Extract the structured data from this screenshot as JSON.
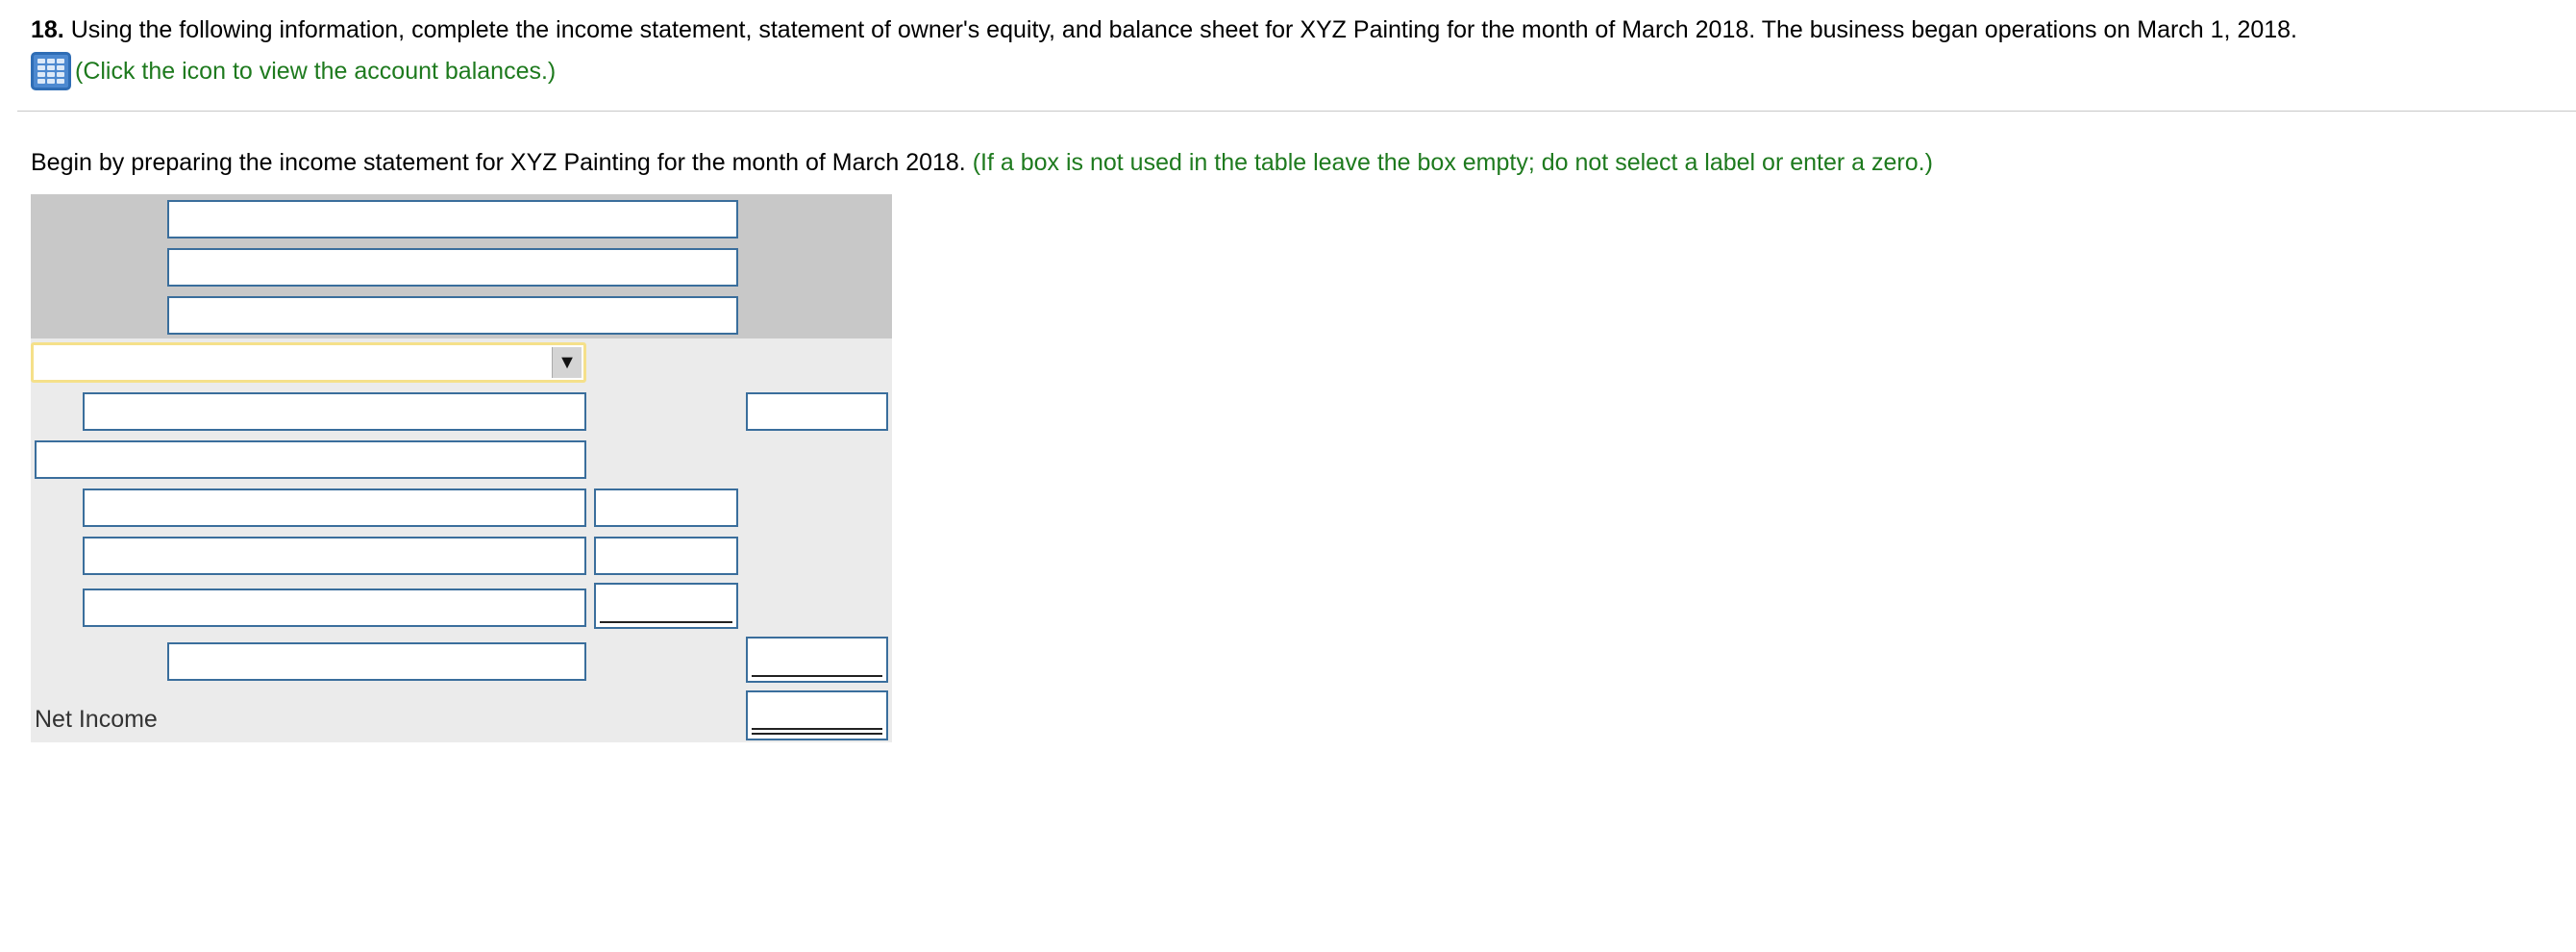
{
  "question": {
    "number": "18.",
    "text": "Using the following information, complete the income statement, statement of owner's equity, and balance sheet for XYZ Painting for the month of March 2018. The business began operations on March 1, 2018.",
    "account_link": "(Click the icon to view the account balances.)",
    "account_icon": "table-grid-icon"
  },
  "instruction": {
    "text": "Begin by preparing the income statement for XYZ Painting for the month of March 2018.",
    "note": "(If a box is not used in the table leave the box empty; do not select a label or enter a zero.)"
  },
  "statement": {
    "header_inputs": [
      "",
      "",
      ""
    ],
    "revenue_dropdown": {
      "selected": "",
      "arrow": "▼"
    },
    "revenue_line": {
      "label": "",
      "amount": ""
    },
    "expenses_heading": "",
    "expense_rows": [
      {
        "label": "",
        "amount": ""
      },
      {
        "label": "",
        "amount": ""
      },
      {
        "label": "",
        "amount": ""
      }
    ],
    "total_expenses": {
      "label": "",
      "amount": ""
    },
    "net_income": {
      "label": "Net Income",
      "amount": ""
    }
  },
  "colors": {
    "link_green": "#1e7a1e",
    "header_band": "#c8c8c8",
    "body_band": "#ebebeb",
    "input_border": "#3a6e9c",
    "dropdown_highlight": "#f5e08a"
  }
}
